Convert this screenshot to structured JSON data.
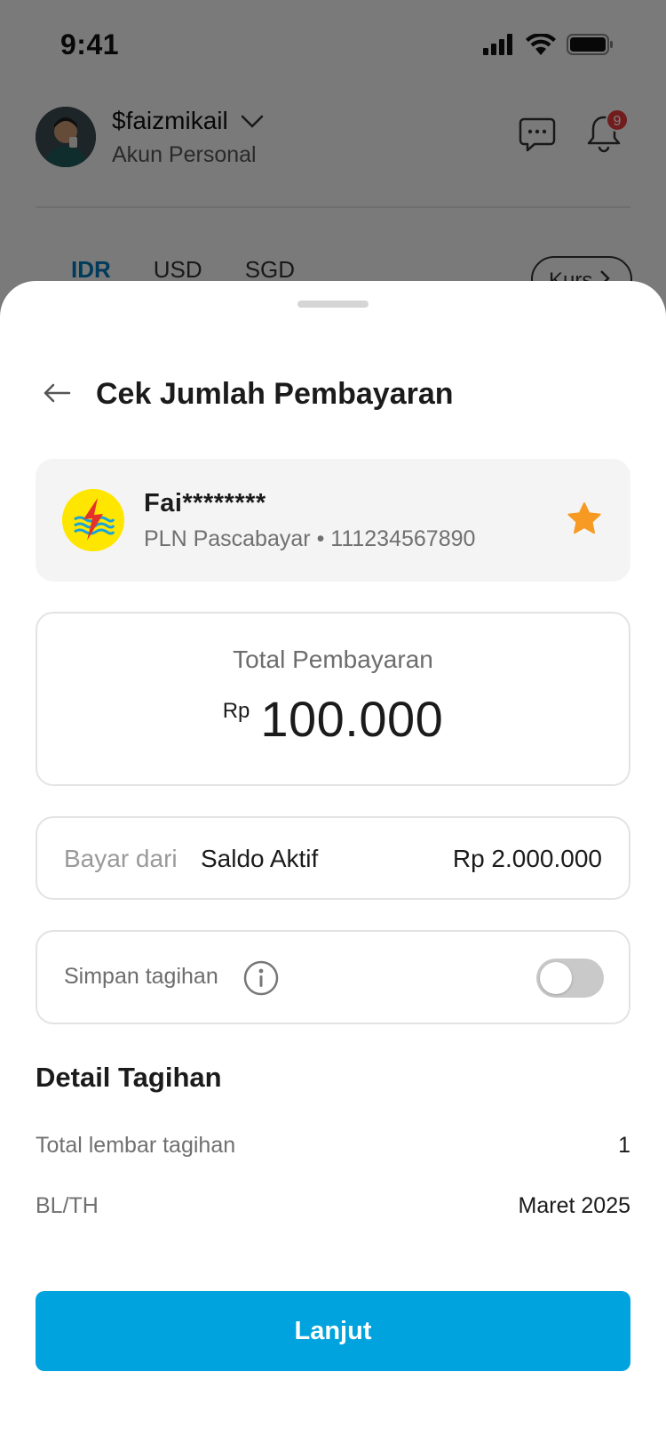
{
  "status_bar": {
    "time": "9:41"
  },
  "account": {
    "username": "$faizmikail",
    "type": "Akun Personal",
    "notification_count": "9"
  },
  "currency_tabs": [
    "IDR",
    "USD",
    "SGD"
  ],
  "kurs_label": "Kurs",
  "sheet": {
    "title": "Cek Jumlah Pembayaran",
    "customer": {
      "name": "Fai********",
      "service": "PLN Pascabayar",
      "separator": "•",
      "account_number": "111234567890"
    },
    "total": {
      "label": "Total Pembayaran",
      "currency": "Rp",
      "value": "100.000"
    },
    "pay_from": {
      "label": "Bayar dari",
      "source": "Saldo Aktif",
      "balance": "Rp 2.000.000"
    },
    "save_bill": {
      "label": "Simpan tagihan",
      "enabled": false
    },
    "detail": {
      "title": "Detail Tagihan",
      "rows": [
        {
          "key": "Total lembar tagihan",
          "value": "1"
        },
        {
          "key": "BL/TH",
          "value": "Maret 2025"
        }
      ]
    },
    "cta_label": "Lanjut"
  },
  "colors": {
    "primary": "#00a3dd",
    "tab_active": "#0077b6",
    "star": "#f79a23",
    "pln_yellow": "#ffe600",
    "badge": "#e23b3b"
  },
  "icons": [
    "signal-icon",
    "wifi-icon",
    "battery-icon",
    "chevron-down-icon",
    "chat-icon",
    "bell-icon",
    "back-arrow-icon",
    "pln-logo",
    "star-icon",
    "info-icon",
    "chevron-right-icon"
  ]
}
